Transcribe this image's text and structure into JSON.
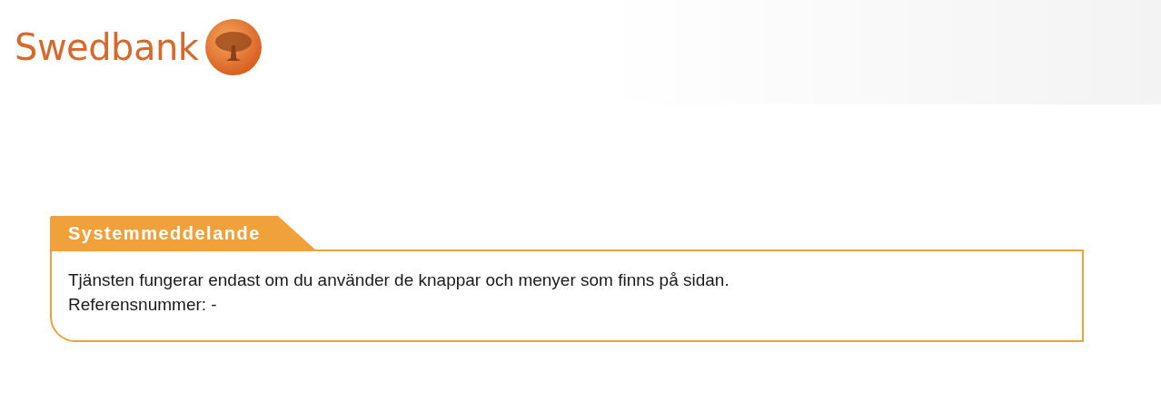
{
  "header": {
    "logo": "Swedbank"
  },
  "message": {
    "title": "Systemmeddelande",
    "lines": [
      "Tjänsten fungerar endast om du använder de knappar och menyer som finns på sidan.",
      "Referensnummer: -"
    ]
  }
}
